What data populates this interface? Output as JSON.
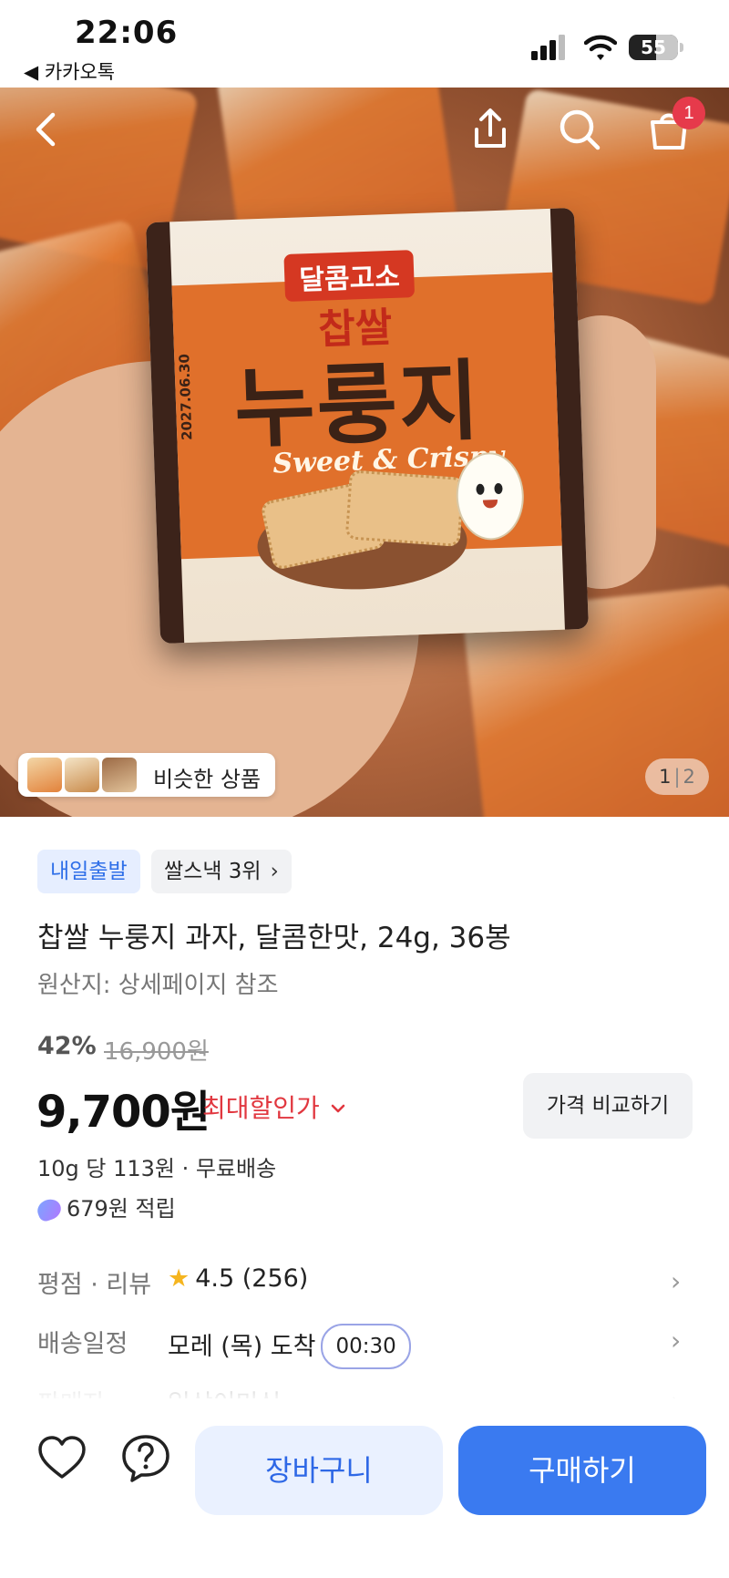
{
  "status_bar": {
    "time": "22:06",
    "back_app": "◀ 카카오톡",
    "battery": "55"
  },
  "hero": {
    "package": {
      "tagline": "달콤고소",
      "brand_sub": "찹쌀",
      "name": "누룽지",
      "english": "Sweet & Crispy",
      "date": "2027.06.30"
    },
    "cart_badge": "1",
    "similar_label": "비슷한 상품",
    "page_current": "1",
    "page_total": "2"
  },
  "product": {
    "badges": {
      "delivery": "내일출발",
      "rank": "쌀스낵 3위"
    },
    "title": "찹쌀 누룽지 과자, 달콤한맛, 24g, 36봉",
    "origin": "원산지: 상세페이지 참조",
    "discount": "42%",
    "original_price": "16,900원",
    "price": "9,700원",
    "max_discount_label": "최대할인가",
    "compare_button": "가격 비교하기",
    "unit_price": "10g 당 113원 · 무료배송",
    "points": "679원 적립"
  },
  "info_rows": {
    "rating": {
      "label": "평점 · 리뷰",
      "value": "4.5 (256)"
    },
    "shipping": {
      "label": "배송일정",
      "value": "모레 (목) 도착",
      "timer": "00:30"
    },
    "seller": {
      "label": "판매자",
      "value": "일상이미식"
    }
  },
  "bottom_bar": {
    "cart_button": "장바구니",
    "buy_button": "구매하기"
  },
  "colors": {
    "accent_blue": "#3a7af0",
    "chip_blue_text": "#2f6fe8",
    "discount_red": "#e1373f",
    "badge_red": "#e63a4b",
    "star_yellow": "#f5b51f"
  },
  "icons": {
    "back": "chevron-left-icon",
    "share": "share-icon",
    "search": "search-icon",
    "cart": "cart-icon",
    "wishlist": "heart-icon",
    "help": "question-icon",
    "rating": "star-icon",
    "points": "points-icon"
  }
}
